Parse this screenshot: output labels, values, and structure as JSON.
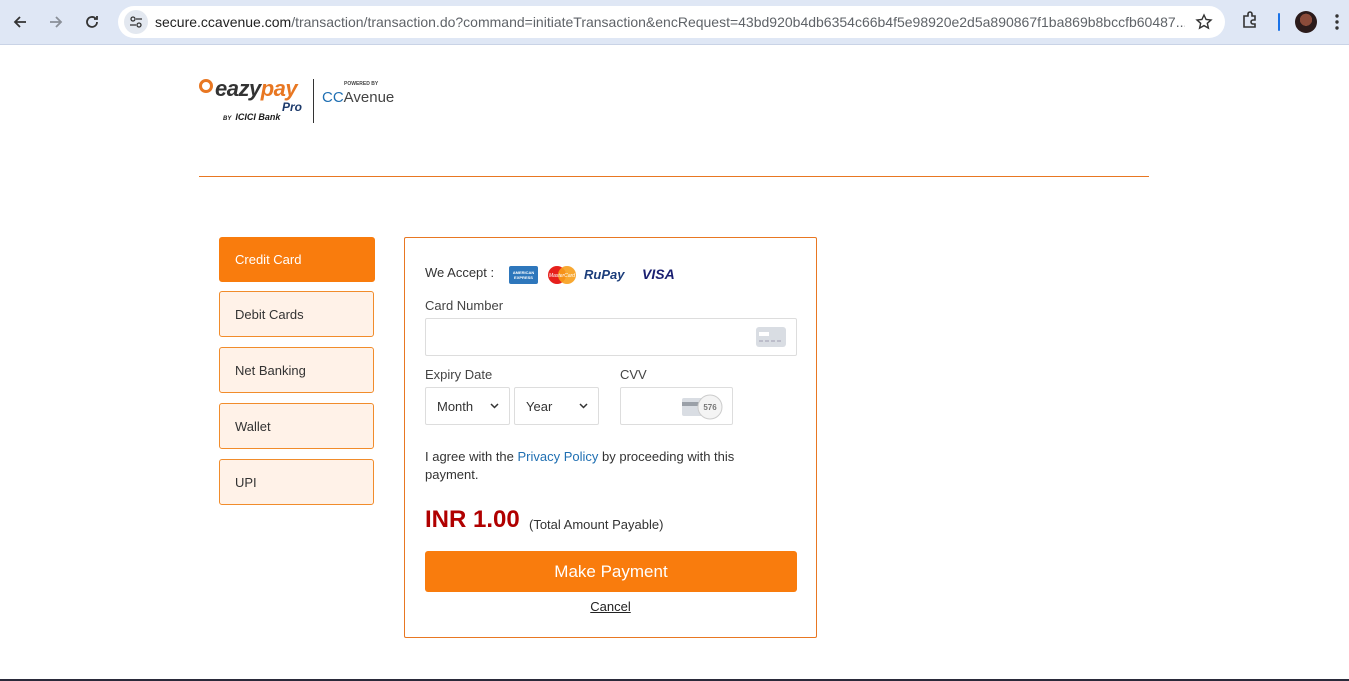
{
  "browser": {
    "url_host": "secure.ccavenue.com",
    "url_rest": "/transaction/transaction.do?command=initiateTransaction&encRequest=43bd920b4db6354c66b4f5e98920e2d5a890867f1ba869b8bccfb60487...",
    "icons": [
      "back-arrow-icon",
      "forward-arrow-icon",
      "reload-icon",
      "site-info-icon",
      "star-icon",
      "extensions-icon",
      "avatar",
      "more-menu-icon"
    ]
  },
  "logo": {
    "eazy": "eazy",
    "pay": "pay",
    "pro": "Pro",
    "by": "BY",
    "bank": "ICICI Bank",
    "powered_by": "POWERED BY",
    "cc": "CC",
    "avenue": "Avenue"
  },
  "tabs": [
    {
      "label": "Credit Card",
      "active": true
    },
    {
      "label": "Debit Cards",
      "active": false
    },
    {
      "label": "Net Banking",
      "active": false
    },
    {
      "label": "Wallet",
      "active": false
    },
    {
      "label": "UPI",
      "active": false
    }
  ],
  "form": {
    "we_accept": "We Accept :",
    "accepted_cards": {
      "amex": "AMERICAN EXPRESS",
      "mastercard": "MasterCard",
      "rupay": "RuPay",
      "visa": "VISA"
    },
    "card_number_label": "Card Number",
    "card_number_value": "",
    "expiry_label": "Expiry Date",
    "month_selected": "Month",
    "year_selected": "Year",
    "cvv_label": "CVV",
    "cvv_hint": "576",
    "agree_pre": "I agree with the ",
    "privacy_link": "Privacy Policy",
    "agree_post": " by proceeding with this payment.",
    "amount": "INR 1.00",
    "amount_note": "(Total Amount Payable)",
    "pay_button": "Make Payment",
    "cancel": "Cancel"
  },
  "colors": {
    "accent": "#f97c0d",
    "tab_bg": "#fff2e8",
    "amount": "#b00000",
    "link": "#1f6fb2"
  }
}
